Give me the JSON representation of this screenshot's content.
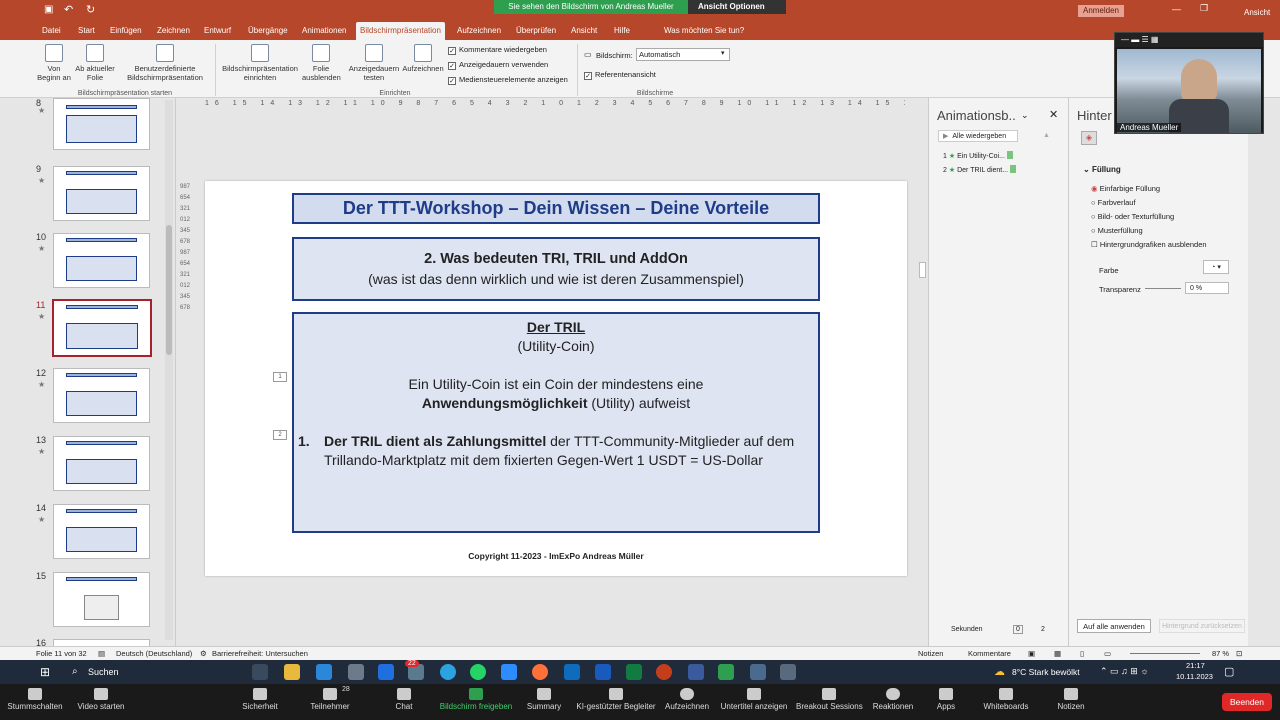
{
  "window": {
    "share_banner": "Sie sehen den Bildschirm von Andreas Mueller",
    "view_options": "Ansicht Optionen",
    "sign_in": "Anmelden",
    "view_label": "Ansicht"
  },
  "tabs": [
    "Datei",
    "Start",
    "Einfügen",
    "Zeichnen",
    "Entwurf",
    "Übergänge",
    "Animationen",
    "Bildschirmpräsentation",
    "Aufzeichnen",
    "Überprüfen",
    "Ansicht",
    "Hilfe"
  ],
  "search_hint": "Was möchten Sie tun?",
  "ribbon": {
    "from_start": "Von Beginn an",
    "from_current": "Ab aktueller Folie",
    "custom": "Benutzerdefinierte Bildschirmpräsentation",
    "group_start": "Bildschirmpräsentation starten",
    "setup": "Bildschirmpräsentation einrichten",
    "hide": "Folie ausblenden",
    "rehearse": "Anzeigedauern testen",
    "record": "Aufzeichnen",
    "group_setup": "Einrichten",
    "chk_comments": "Kommentare wiedergeben",
    "chk_timings": "Anzeigedauern verwenden",
    "chk_media": "Mediensteuerelemente anzeigen",
    "screen_label": "Bildschirm:",
    "screen_value": "Automatisch",
    "presenter_view": "Referentenansicht",
    "group_monitors": "Bildschirme"
  },
  "ruler_text": "16 15 14 13 12 11 10 9 8 7 6 5 4 3 2 1 0 1 2 3 4 5 6 7 8 9 10 11 12 13 14 15 16",
  "vruler_text": "987654321012345678987654321012345678",
  "thumbs": [
    {
      "num": "8"
    },
    {
      "num": "9"
    },
    {
      "num": "10"
    },
    {
      "num": "11"
    },
    {
      "num": "12"
    },
    {
      "num": "13"
    },
    {
      "num": "14"
    },
    {
      "num": "15"
    },
    {
      "num": "16"
    }
  ],
  "slide": {
    "title": "Der TTT-Workshop – Dein Wissen – Deine Vorteile",
    "sub_line1": "2.   Was bedeuten TRI, TRIL und AddOn",
    "sub_line2": "(was ist das denn wirklich und wie ist deren Zusammenspiel)",
    "main_heading": "Der TRIL",
    "main_sub": "(Utility-Coin)",
    "def_line1": "Ein Utility-Coin ist ein Coin der mindestens eine",
    "def_bold": "Anwendungsmöglichkeit",
    "def_rest": " (Utility) aufweist",
    "item_num": "1.",
    "item_bold": "Der TRIL dient als Zahlungsmittel",
    "item_rest": " der TTT-Community-Mitglieder auf dem Trillando-Marktplatz mit dem fixierten Gegen-Wert 1 USDT = US-Dollar",
    "copyright": "Copyright 11-2023 - ImExPo Andreas Müller",
    "anim_tag1": "1",
    "anim_tag2": "2"
  },
  "anim_pane": {
    "title": "Animationsb..",
    "play_all": "Alle wiedergeben",
    "items": [
      {
        "num": "1",
        "label": "Ein Utility-Coi..."
      },
      {
        "num": "2",
        "label": "Der TRIL dient..."
      }
    ],
    "seconds": "Sekunden",
    "sec_from": "0",
    "sec_to": "2"
  },
  "bg_pane": {
    "title": "Hinter",
    "section": "Füllung",
    "opt1": "Einfarbige Füllung",
    "opt2": "Farbverlauf",
    "opt3": "Bild- oder Texturfüllung",
    "opt4": "Musterfüllung",
    "opt5": "Hintergrundgrafiken ausblenden",
    "color_label": "Farbe",
    "transparency_label": "Transparenz",
    "transparency_value": "0 %",
    "apply_all": "Auf alle anwenden",
    "reset": "Hintergrund zurücksetzen"
  },
  "status": {
    "slide_info": "Folie 11 von 32",
    "language": "Deutsch (Deutschland)",
    "accessibility": "Barrierefreiheit: Untersuchen",
    "notes": "Notizen",
    "comments": "Kommentare",
    "zoom": "87 %"
  },
  "taskbar": {
    "search": "Suchen",
    "weather": "8°C  Stark bewölkt",
    "time": "21:17",
    "date": "10.11.2023",
    "badge": "22"
  },
  "zoom": {
    "mute": "Stummschalten",
    "video": "Video starten",
    "security": "Sicherheit",
    "participants": "Teilnehmer",
    "participants_count": "28",
    "chat": "Chat",
    "share": "Bildschirm freigeben",
    "summary": "Summary",
    "ai": "KI-gestützter Begleiter",
    "record": "Aufzeichnen",
    "captions": "Untertitel anzeigen",
    "breakout": "Breakout Sessions",
    "reactions": "Reaktionen",
    "apps": "Apps",
    "whiteboards": "Whiteboards",
    "notes": "Notizen",
    "end": "Beenden",
    "speaker": "Andreas Mueller"
  },
  "colors": {
    "ppt_accent": "#b7472a",
    "slide_border": "#1f3c88",
    "share_green": "#2e9e4f",
    "end_red": "#e02828"
  }
}
